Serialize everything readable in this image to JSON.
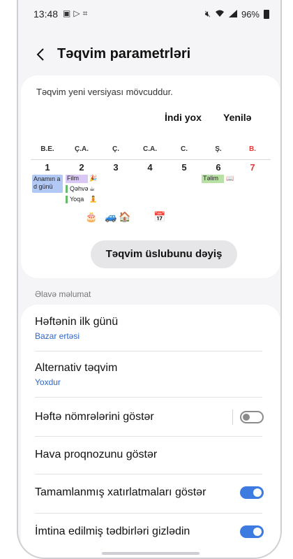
{
  "status": {
    "time": "13:48",
    "battery": "96%",
    "left_icons": [
      "image-icon",
      "play-icon",
      "screenshot-icon"
    ],
    "right_icons": [
      "mute-icon",
      "wifi-icon",
      "signal-icon"
    ]
  },
  "header": {
    "title": "Təqvim parametrləri"
  },
  "update_card": {
    "notice": "Təqvim yeni versiyası mövcuddur.",
    "later_label": "İndi yox",
    "update_label": "Yenilə"
  },
  "calendar": {
    "days_of_week": [
      "B.E.",
      "Ç.A.",
      "Ç.",
      "C.A.",
      "C.",
      "Ş.",
      "B."
    ],
    "dates": [
      "1",
      "2",
      "3",
      "4",
      "5",
      "6",
      "7"
    ],
    "events": {
      "mon": "Anamın a d günü",
      "tue_1": "Film",
      "tue_2": "Qəhvə",
      "tue_3": "Yoqa",
      "sat": "Təlim"
    },
    "sunday_color": "#e53935"
  },
  "style_button": {
    "label": "Təqvim üslubunu dəyiş"
  },
  "section": {
    "label": "Əlavə məlumat"
  },
  "settings": {
    "first_day": {
      "title": "Həftənin ilk günü",
      "value": "Bazar ertəsi"
    },
    "alt_calendar": {
      "title": "Alternativ təqvim",
      "value": "Yoxdur"
    },
    "week_numbers": {
      "title": "Həftə nömrələrini göstər",
      "enabled": false
    },
    "weather": {
      "title": "Hava proqnozunu göstər"
    },
    "completed_reminders": {
      "title": "Tamamlanmış xatırlatmaları göstər",
      "enabled": true
    },
    "hide_declined": {
      "title": "İmtina edilmiş tədbirləri gizlədin",
      "enabled": true
    }
  },
  "colors": {
    "accent": "#3e7be0",
    "link": "#2f66c9"
  }
}
